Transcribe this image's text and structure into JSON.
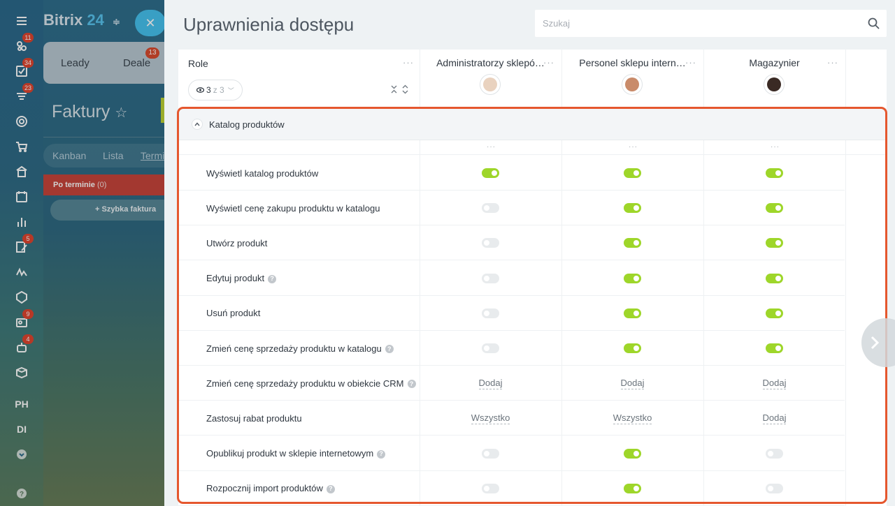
{
  "rail": {
    "items": [
      {
        "icon": "menu-icon",
        "badge": ""
      },
      {
        "icon": "feed-icon",
        "badge": "11"
      },
      {
        "icon": "tasks-icon",
        "badge": "34"
      },
      {
        "icon": "crm-icon",
        "badge": "23"
      },
      {
        "icon": "target-icon",
        "badge": ""
      },
      {
        "icon": "cart-icon",
        "badge": ""
      },
      {
        "icon": "store-icon",
        "badge": ""
      },
      {
        "icon": "calendar-icon",
        "badge": ""
      },
      {
        "icon": "analytics-icon",
        "badge": ""
      },
      {
        "icon": "edit-doc-icon",
        "badge": "5"
      },
      {
        "icon": "sign-icon",
        "badge": ""
      },
      {
        "icon": "shield-icon",
        "badge": ""
      },
      {
        "icon": "contact-card-icon",
        "badge": "9"
      },
      {
        "icon": "bot-icon",
        "badge": "4"
      },
      {
        "icon": "box-icon",
        "badge": ""
      }
    ],
    "text_items": [
      "PH",
      "DI"
    ],
    "more_icon": "chevron-down-circle-icon",
    "help_icon": "help-icon"
  },
  "background": {
    "logo_main": "Bitrix",
    "logo_num": "24",
    "tabs": [
      "Leady",
      "Deale"
    ],
    "deal_badge": "13",
    "title": "Faktury",
    "views": [
      "Kanban",
      "Lista",
      "Termi"
    ],
    "column": {
      "name": "Po terminie",
      "count": "(0)"
    },
    "quick": "+ Szybka faktura"
  },
  "panel": {
    "title": "Uprawnienia dostępu",
    "search_placeholder": "Szukaj"
  },
  "header": {
    "role_label": "Role",
    "filter_current": "3",
    "filter_of": "z 3",
    "roles": [
      {
        "name": "Administratorzy sklepó…",
        "avatar_color": "#e9d2bf"
      },
      {
        "name": "Personel sklepu intern…",
        "avatar_color": "#c98b6a"
      },
      {
        "name": "Magazynier",
        "avatar_color": "#3a2a24"
      }
    ]
  },
  "section": {
    "title": "Katalog produktów",
    "rows": [
      {
        "label": "Wyświetl katalog produktów",
        "help": false,
        "cells": [
          {
            "type": "toggle",
            "on": true
          },
          {
            "type": "toggle",
            "on": true
          },
          {
            "type": "toggle",
            "on": true
          }
        ]
      },
      {
        "label": "Wyświetl cenę zakupu produktu w katalogu",
        "help": false,
        "cells": [
          {
            "type": "toggle",
            "on": false
          },
          {
            "type": "toggle",
            "on": true
          },
          {
            "type": "toggle",
            "on": true
          }
        ]
      },
      {
        "label": "Utwórz produkt",
        "help": false,
        "cells": [
          {
            "type": "toggle",
            "on": false
          },
          {
            "type": "toggle",
            "on": true
          },
          {
            "type": "toggle",
            "on": true
          }
        ]
      },
      {
        "label": "Edytuj produkt",
        "help": true,
        "cells": [
          {
            "type": "toggle",
            "on": false
          },
          {
            "type": "toggle",
            "on": true
          },
          {
            "type": "toggle",
            "on": true
          }
        ]
      },
      {
        "label": "Usuń produkt",
        "help": false,
        "cells": [
          {
            "type": "toggle",
            "on": false
          },
          {
            "type": "toggle",
            "on": true
          },
          {
            "type": "toggle",
            "on": true
          }
        ]
      },
      {
        "label": "Zmień cenę sprzedaży produktu w katalogu",
        "help": true,
        "cells": [
          {
            "type": "toggle",
            "on": false
          },
          {
            "type": "toggle",
            "on": true
          },
          {
            "type": "toggle",
            "on": true
          }
        ]
      },
      {
        "label": "Zmień cenę sprzedaży produktu w obiekcie CRM",
        "help": true,
        "cells": [
          {
            "type": "link",
            "text": "Dodaj"
          },
          {
            "type": "link",
            "text": "Dodaj"
          },
          {
            "type": "link",
            "text": "Dodaj"
          }
        ]
      },
      {
        "label": "Zastosuj rabat produktu",
        "help": false,
        "cells": [
          {
            "type": "link",
            "text": "Wszystko"
          },
          {
            "type": "link",
            "text": "Wszystko"
          },
          {
            "type": "link",
            "text": "Dodaj"
          }
        ]
      },
      {
        "label": "Opublikuj produkt w sklepie internetowym",
        "help": true,
        "cells": [
          {
            "type": "toggle",
            "on": false
          },
          {
            "type": "toggle",
            "on": true
          },
          {
            "type": "toggle",
            "on": false
          }
        ]
      },
      {
        "label": "Rozpocznij import produktów",
        "help": true,
        "cells": [
          {
            "type": "toggle",
            "on": false
          },
          {
            "type": "toggle",
            "on": true
          },
          {
            "type": "toggle",
            "on": false
          }
        ]
      }
    ]
  },
  "colors": {
    "toggle_on": "#9ed62a",
    "toggle_off": "#e8ebed",
    "highlight": "#e5572e",
    "accent_blue": "#46c2ef"
  }
}
